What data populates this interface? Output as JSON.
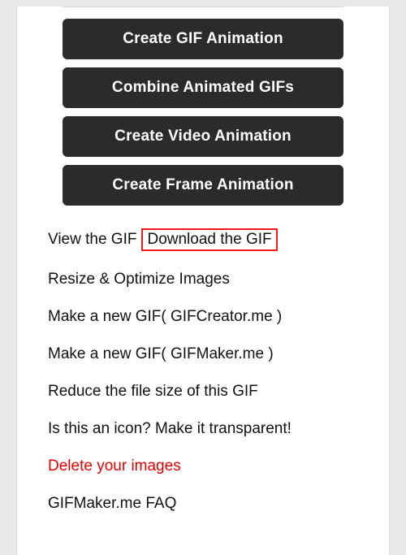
{
  "buttons": {
    "create_gif": "Create GIF Animation",
    "combine_gifs": "Combine Animated GIFs",
    "create_video": "Create Video Animation",
    "create_frame": "Create Frame Animation"
  },
  "links": {
    "view_gif": "View the GIF",
    "download_gif": "Download the GIF",
    "resize_optimize": "Resize & Optimize Images",
    "make_gif_creator": "Make a new GIF( GIFCreator.me )",
    "make_gif_maker": "Make a new GIF( GIFMaker.me )",
    "reduce_size": "Reduce the file size of this GIF",
    "make_transparent": "Is this an icon? Make it transparent!",
    "delete_images": "Delete your images",
    "faq": "GIFMaker.me FAQ"
  }
}
